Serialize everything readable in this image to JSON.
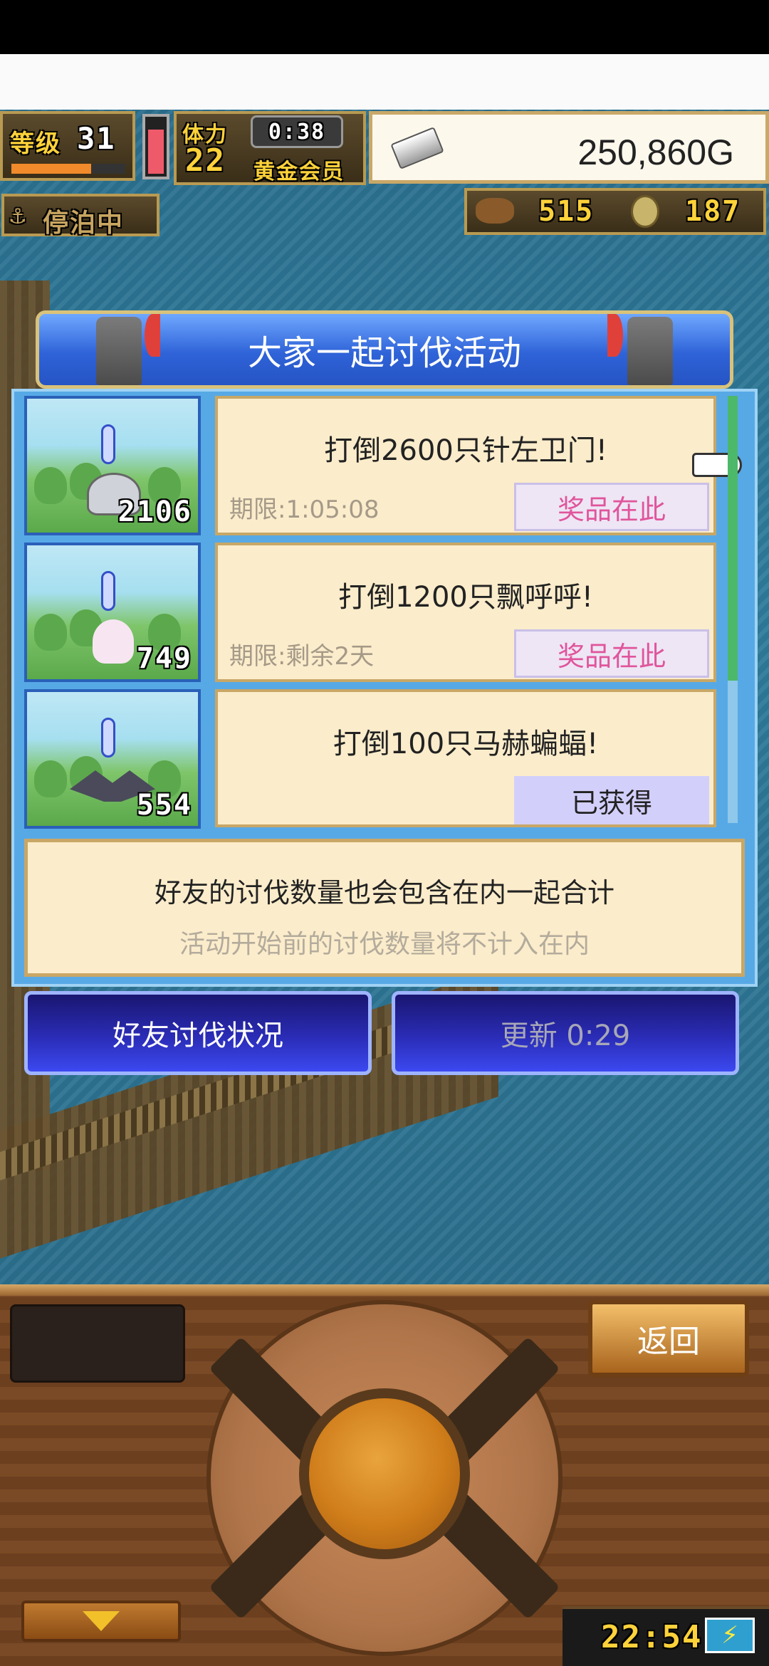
{
  "hud": {
    "level_label": "等级",
    "level_value": "31",
    "stamina_label": "体力",
    "stamina_value": "22",
    "timer": "0:38",
    "membership": "黄金会员",
    "gold": "250,860G",
    "docked_status": "停泊中",
    "resource_1": "515",
    "resource_2": "187"
  },
  "dialog": {
    "title": "大家一起讨伐活动",
    "missions": [
      {
        "count": "2106",
        "title": "打倒2600只针左卫门!",
        "deadline": "期限:1:05:08",
        "button": "奖品在此",
        "state": "prize"
      },
      {
        "count": "749",
        "title": "打倒1200只飘呼呼!",
        "deadline": "期限:剩余2天",
        "button": "奖品在此",
        "state": "prize"
      },
      {
        "count": "554",
        "title": "打倒100只马赫蝙蝠!",
        "deadline": "",
        "button": "已获得",
        "state": "obtained"
      }
    ],
    "note_line1": "好友的讨伐数量也会包含在内一起合计",
    "note_line2": "活动开始前的讨伐数量将不计入在内",
    "friend_status_button": "好友讨伐状况",
    "refresh_button": "更新 0:29"
  },
  "controls": {
    "back_button": "返回",
    "clock": "22:54"
  },
  "colors": {
    "prize_text": "#e0559c",
    "dialog_title_bg": "#2f63d8",
    "card_bg": "#fbeccb",
    "obtained_bg": "#d3cffb"
  }
}
